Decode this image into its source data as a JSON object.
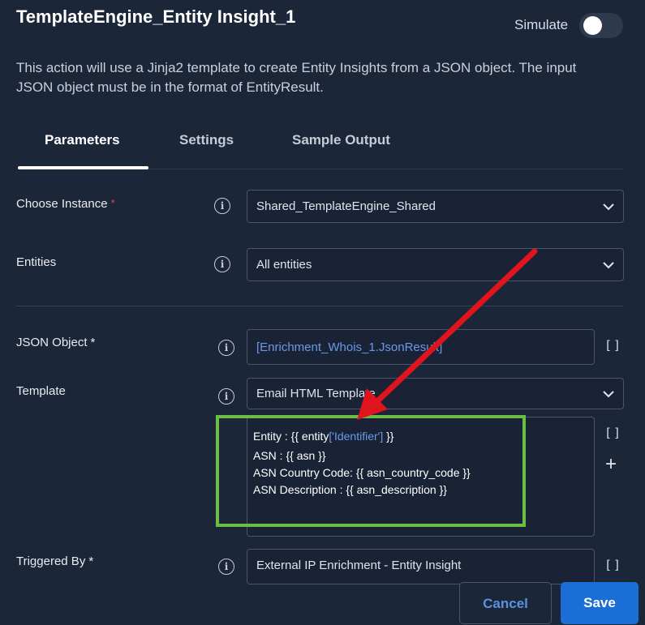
{
  "header": {
    "title": "TemplateEngine_Entity Insight_1",
    "simulate_label": "Simulate",
    "simulate_on": false
  },
  "description": "This action will use a Jinja2 template to create Entity Insights from a JSON object. The input JSON object must be in the format of EntityResult.",
  "tabs": [
    {
      "label": "Parameters",
      "active": true
    },
    {
      "label": "Settings",
      "active": false
    },
    {
      "label": "Sample Output",
      "active": false
    }
  ],
  "fields": {
    "instance": {
      "label": "Choose Instance",
      "required": "*",
      "value": "Shared_TemplateEngine_Shared"
    },
    "entities": {
      "label": "Entities",
      "value": "All entities"
    },
    "json_object": {
      "label": "JSON Object",
      "required": "*",
      "value": "[Enrichment_Whois_1.JsonResult]"
    },
    "template": {
      "label": "Template",
      "value": "Email HTML Template",
      "code": {
        "line1_prefix": "Entity :  {{ entity",
        "line1_key": "['Identifier']",
        "line1_suffix": " }}",
        "line2": "ASN : {{ asn }}",
        "line3": "ASN Country Code: {{ asn_country_code }}",
        "line4": "ASN Description : {{ asn_description }}"
      }
    },
    "triggered_by": {
      "label": "Triggered By",
      "required": "*",
      "value": "External IP Enrichment - Entity Insight"
    }
  },
  "icons": {
    "info": "info-icon",
    "brackets": "[]",
    "plus": "+",
    "chevron": "chevron-down-icon"
  },
  "buttons": {
    "cancel": "Cancel",
    "save": "Save"
  },
  "colors": {
    "background": "#1c2639",
    "accent": "#1b6ed6",
    "link": "#6a9ae6",
    "annotation_arrow": "#e0141c",
    "highlight_box": "#6abe45"
  }
}
